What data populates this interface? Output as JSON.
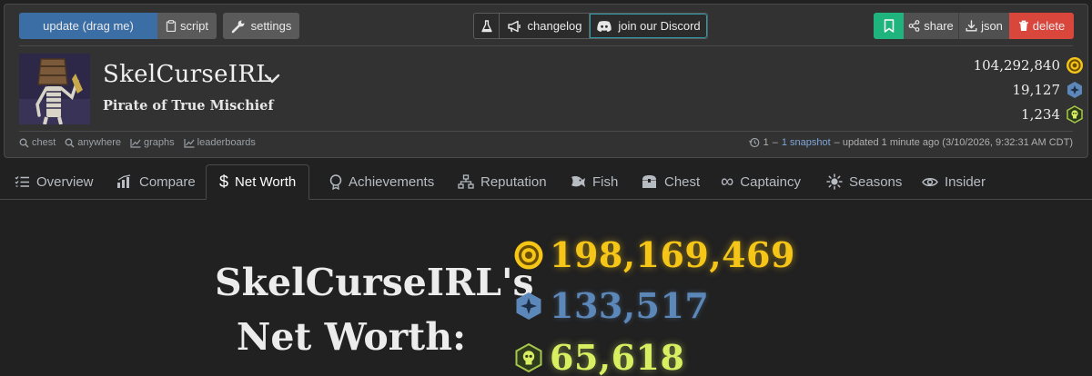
{
  "toolbar": {
    "update_label": "update (drag me)",
    "script_label": "script",
    "settings_label": "settings",
    "changelog_label": "changelog",
    "discord_label": "join our Discord",
    "share_label": "share",
    "json_label": "json",
    "delete_label": "delete"
  },
  "profile": {
    "name": "SkelCurseIRL",
    "title": "Pirate of True Mischief",
    "gold": "104,292,840",
    "doubloons": "19,127",
    "ancient_coins": "1,234"
  },
  "links": {
    "chest": "chest",
    "anywhere": "anywhere",
    "graphs": "graphs",
    "leaderboards": "leaderboards"
  },
  "snapshot": {
    "count": "1",
    "dash": "–",
    "link": "1 snapshot",
    "updated": "– updated 1 minute ago (3/10/2026, 9:32:31 AM CDT)"
  },
  "tabs": [
    {
      "label": "Overview"
    },
    {
      "label": "Compare"
    },
    {
      "label": "Net Worth"
    },
    {
      "label": "Achievements"
    },
    {
      "label": "Reputation"
    },
    {
      "label": "Fish"
    },
    {
      "label": "Chest"
    },
    {
      "label": "Captaincy"
    },
    {
      "label": "Seasons"
    },
    {
      "label": "Insider"
    }
  ],
  "networth": {
    "title_line1": "SkelCurseIRL's",
    "title_line2": "Net Worth:",
    "gold": "198,169,469",
    "doubloons": "133,517",
    "ancient_coins": "65,618"
  },
  "colors": {
    "gold": "#f5c518",
    "doubloon": "#5c87b9",
    "ancient": "#d9ef62",
    "update": "#3a6ea5",
    "bookmark": "#1fb47d",
    "delete": "#d9463c"
  }
}
